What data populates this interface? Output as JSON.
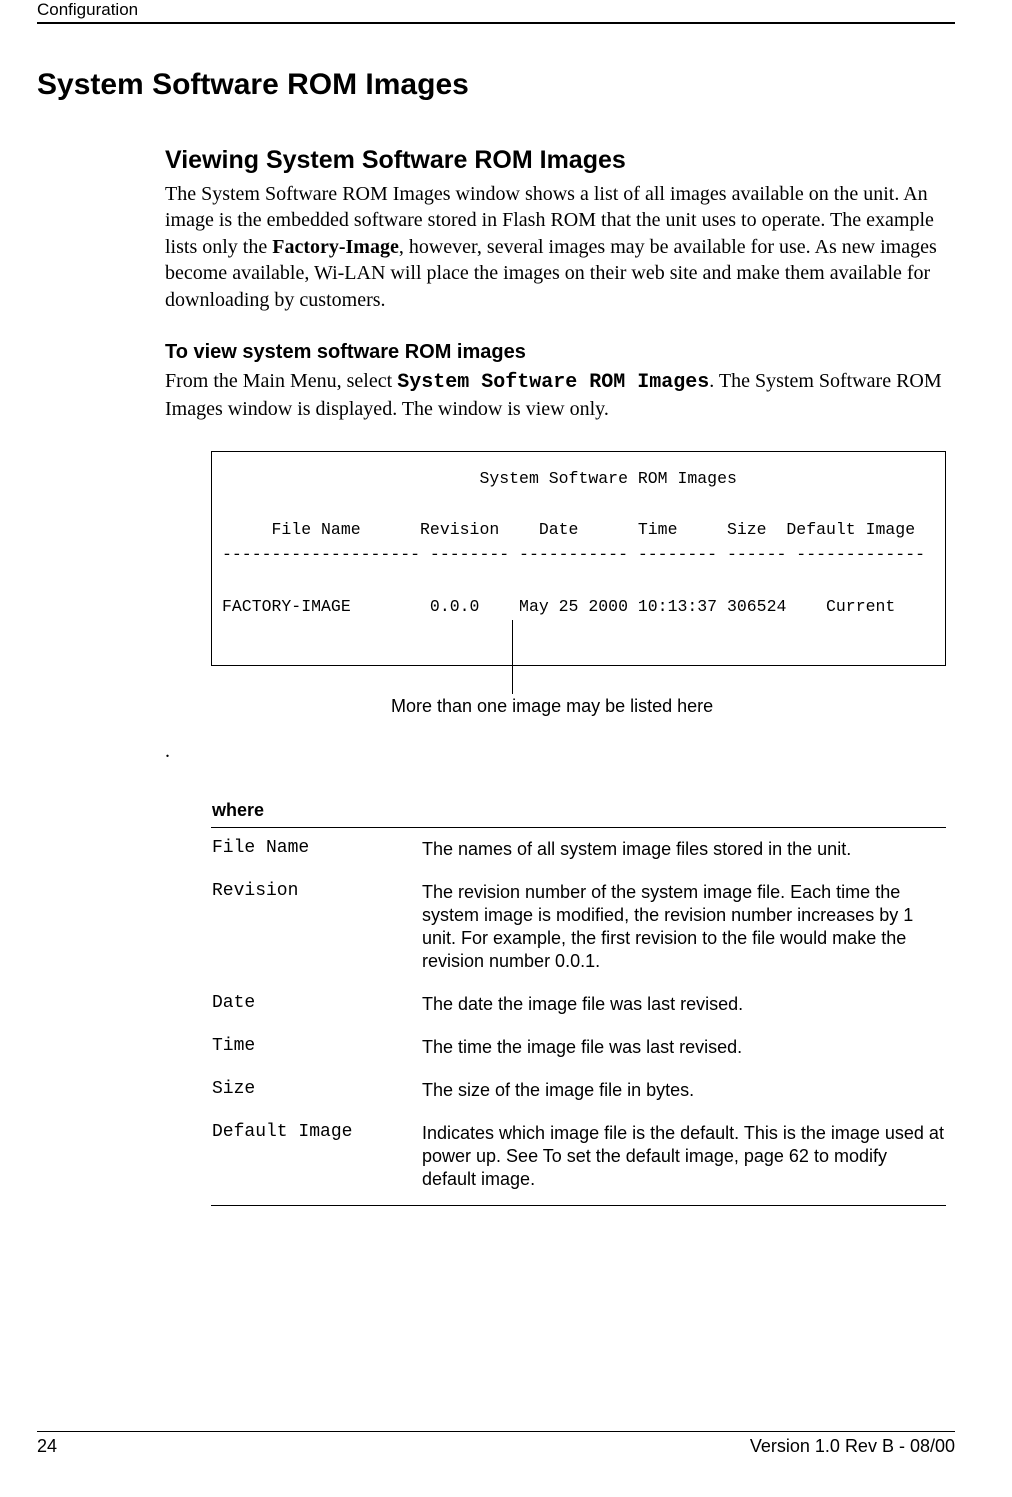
{
  "header": {
    "running": "Configuration"
  },
  "h1": "System Software ROM Images",
  "section": {
    "h2": "Viewing System Software ROM Images",
    "p1a": "The System Software ROM Images window shows a list of all images available on the unit. An image is the embedded software stored in Flash ROM that the unit uses to operate. The example lists only the ",
    "p1b_bold": "Factory-Image",
    "p1c": ", however, several images may be available for use. As new images become available, Wi-LAN will place the images on their web site and make them available for downloading by customers.",
    "h3": "To view system software ROM images",
    "p2a": "From the Main Menu, select ",
    "p2b_mono": "System Software ROM Images",
    "p2c": ". The System Software ROM Images window is displayed. The window is view only."
  },
  "screen": {
    "title": "                          System Software ROM Images",
    "cols": "     File Name      Revision    Date      Time     Size  Default Image",
    "rule": "-------------------- -------- ----------- -------- ------ -------------",
    "row1": "FACTORY-IMAGE        0.0.0    May 25 2000 10:13:37 306524    Current"
  },
  "callout_label": "More than one image may be listed here",
  "period": ".",
  "where": {
    "heading": "where",
    "rows": [
      {
        "term": "File Name",
        "desc": "The names of all system image files stored in the unit."
      },
      {
        "term": "Revision",
        "desc": "The revision number of the system image file. Each time the system image is modified, the revision number increases by 1 unit. For example, the first revision to the file would make the revision number 0.0.1."
      },
      {
        "term": "Date",
        "desc": "The date the image file was last revised."
      },
      {
        "term": "Time",
        "desc": "The time the image file was last revised."
      },
      {
        "term": "Size",
        "desc": "The size of the image file in bytes."
      },
      {
        "term": "Default Image",
        "desc": "Indicates which image file is the default. This is the image used at power up. See To set the default image, page 62 to modify default image."
      }
    ]
  },
  "footer": {
    "page": "24",
    "version": "Version 1.0 Rev B - 08/00"
  }
}
